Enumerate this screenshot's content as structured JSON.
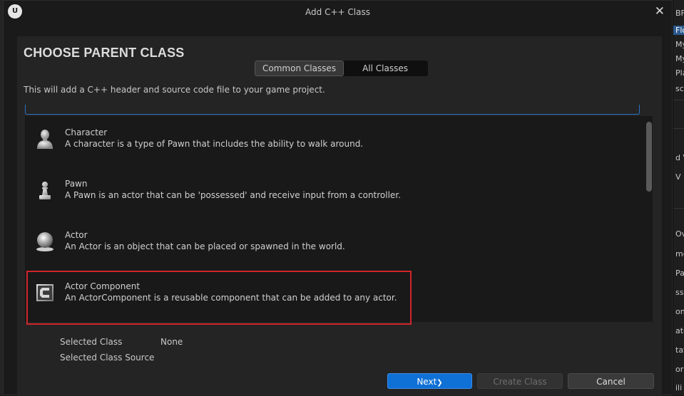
{
  "dialog": {
    "title": "Add C++ Class",
    "logo_text": "U",
    "close_glyph": "✕"
  },
  "panel": {
    "heading": "CHOOSE PARENT CLASS",
    "tabs": [
      {
        "label": "Common Classes",
        "active": true
      },
      {
        "label": "All Classes",
        "active": false
      }
    ],
    "description": "This will add a C++ header and source code file to your game project."
  },
  "classes": [
    {
      "name": "Character",
      "description": "A character is a type of Pawn that includes the ability to walk around.",
      "icon": "character-icon"
    },
    {
      "name": "Pawn",
      "description": "A Pawn is an actor that can be 'possessed' and receive input from a controller.",
      "icon": "pawn-icon"
    },
    {
      "name": "Actor",
      "description": "An Actor is an object that can be placed or spawned in the world.",
      "icon": "actor-icon"
    },
    {
      "name": "Actor Component",
      "description": "An ActorComponent is a reusable component that can be added to any actor.",
      "icon": "component-icon"
    }
  ],
  "selection": {
    "class_label": "Selected Class",
    "class_value": "None",
    "source_label": "Selected Class Source"
  },
  "buttons": {
    "next": "Next",
    "next_glyph": "❯",
    "create": "Create Class",
    "cancel": "Cancel"
  },
  "background_panel": {
    "items": [
      "BF",
      "Flo",
      "My",
      "My",
      "Pla",
      "sc",
      "d V",
      "V",
      "Ov",
      "me",
      "Pav",
      "ss",
      "ont",
      "ate",
      "tat",
      "or C",
      "ili"
    ]
  },
  "colors": {
    "accent": "#0f70d6",
    "highlight": "#d0252b",
    "search_border": "#2c73c9"
  }
}
